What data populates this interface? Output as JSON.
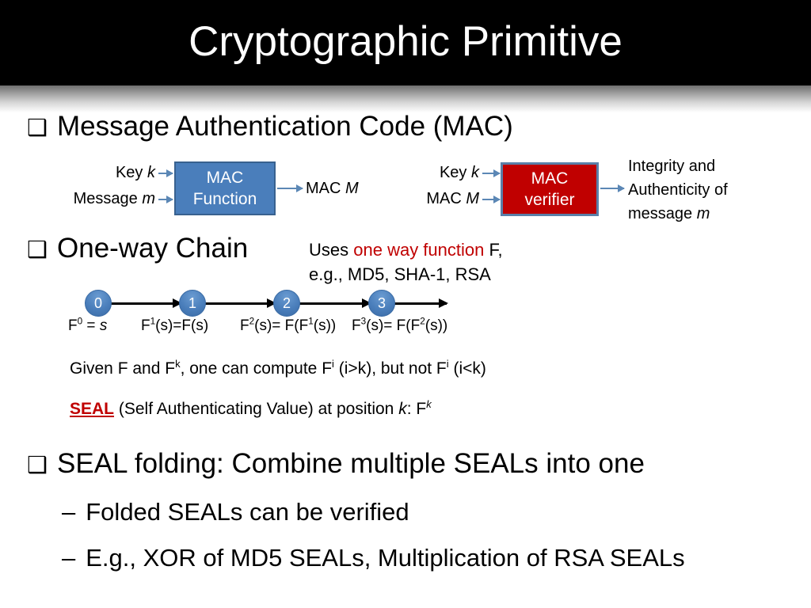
{
  "slide": {
    "title": "Cryptographic Primitive"
  },
  "bullets": {
    "marker_square": "❑",
    "marker_dash": "–",
    "mac": "Message Authentication Code (MAC)",
    "one_way_chain": "One-way Chain",
    "seal_folding": "SEAL folding: Combine multiple SEALs into one",
    "sub_folded": "Folded SEALs can be verified",
    "sub_eg": "E.g., XOR of MD5 SEALs, Multiplication of RSA SEALs"
  },
  "mac_diagram": {
    "input_key": "Key",
    "input_key_var": "k",
    "input_message": "Message",
    "input_message_var": "m",
    "box_line1": "MAC",
    "box_line2": "Function",
    "output_label": "MAC",
    "output_var": "M",
    "box_color": "#4a7ebb"
  },
  "mac_verifier": {
    "input_key": "Key",
    "input_key_var": "k",
    "input_mac": "MAC",
    "input_mac_var": "M",
    "box_line1": "MAC",
    "box_line2": "verifier",
    "out_line1": "Integrity and",
    "out_line2": "Authenticity of",
    "out_line3": "message",
    "out_line3_var": "m",
    "box_color": "#c00000"
  },
  "one_way_note": {
    "line1_pre": "Uses ",
    "line1_red": "one way function",
    "line1_post": " F,",
    "line2": "e.g., MD5, SHA-1, RSA",
    "highlight_color": "#c00000"
  },
  "chain": {
    "nodes": [
      "0",
      "1",
      "2",
      "3"
    ],
    "labels": [
      {
        "main": "F",
        "sup": "0",
        "rest": " = ",
        "ital": "s"
      },
      {
        "main": "F",
        "sup": "1",
        "rest": "(s)=F(s)"
      },
      {
        "main": "F",
        "sup": "2",
        "rest": "(s)= F(F",
        "sup2": "1",
        "rest2": "(s))"
      },
      {
        "main": "F",
        "sup": "3",
        "rest": "(s)= F(F",
        "sup2": "2",
        "rest2": "(s))"
      }
    ]
  },
  "chain_text": {
    "given_pre": "Given F and F",
    "given_sup1": "k",
    "given_mid": ", one can compute F",
    "given_sup2": "i",
    "given_mid2": " (i>k), but not F",
    "given_sup3": "i",
    "given_end": " (i<k)",
    "seal_word": "SEAL",
    "seal_rest_pre": " (Self Authenticating Value) at position ",
    "seal_var": "k",
    "seal_rest_post": ": F",
    "seal_sup": "k"
  }
}
